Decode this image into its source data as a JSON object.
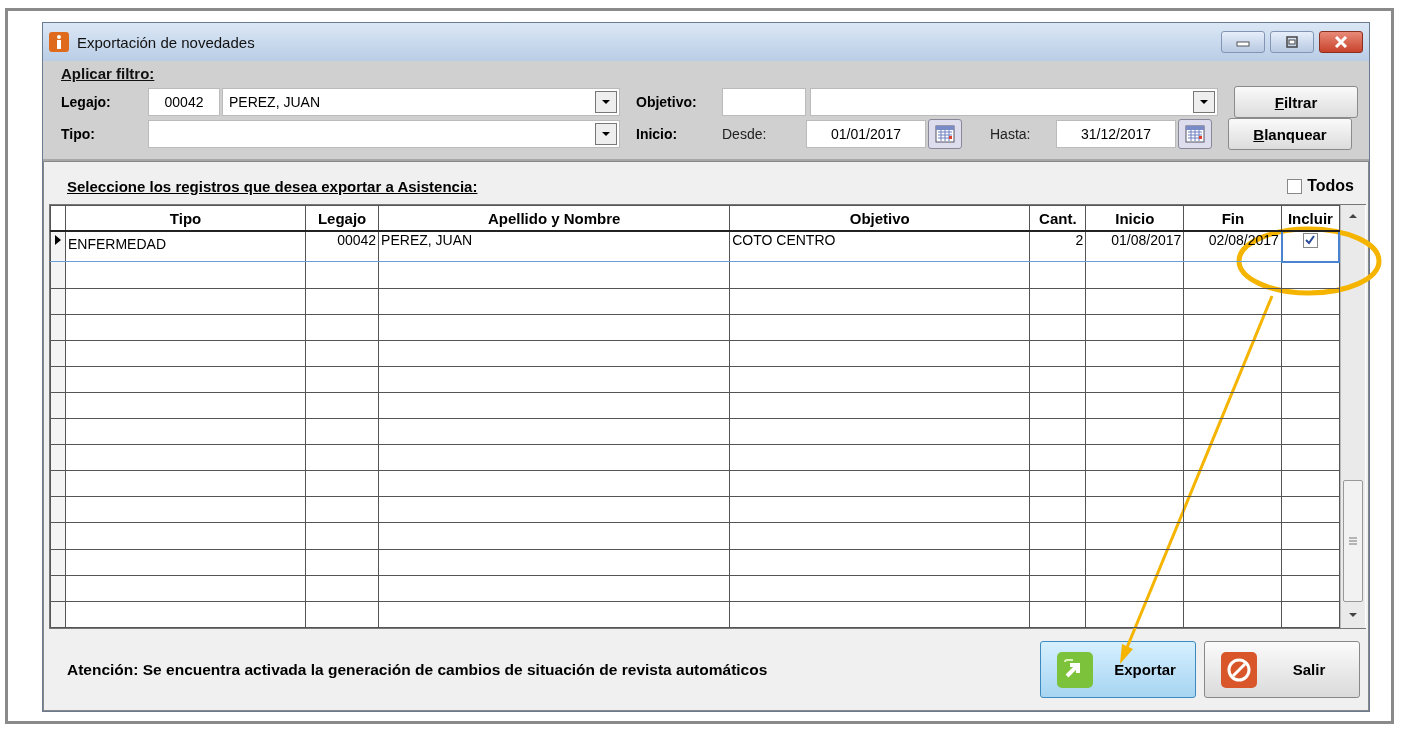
{
  "window": {
    "title": "Exportación de novedades"
  },
  "filter": {
    "heading": "Aplicar filtro:",
    "legajo": {
      "label": "Legajo:",
      "code": "00042",
      "name": "PEREZ, JUAN"
    },
    "objetivo": {
      "label": "Objetivo:"
    },
    "tipo": {
      "label": "Tipo:"
    },
    "inicio": {
      "label": "Inicio:",
      "desde_label": "Desde:",
      "desde": "01/01/2017",
      "hasta_label": "Hasta:",
      "hasta": "31/12/2017"
    },
    "buttons": [
      {
        "label": "Filtrar",
        "mnemonic": true
      },
      {
        "label": "Blanquear",
        "mnemonic": true
      }
    ]
  },
  "selection": {
    "heading": "Seleccione los registros que desea exportar a Asistencia:",
    "todos": {
      "label": "Todos",
      "checked": false
    }
  },
  "table": {
    "columns": [
      "Tipo",
      "Legajo",
      "Apellido y Nombre",
      "Objetivo",
      "Cant.",
      "Inicio",
      "Fin",
      "Incluir"
    ],
    "rows": [
      {
        "selected": true,
        "cells": [
          "ENFERMEDAD",
          "00042",
          "PEREZ, JUAN",
          "COTO CENTRO",
          "2",
          "01/08/2017",
          "02/08/2017"
        ],
        "incluir": true
      }
    ]
  },
  "message": "Atención: Se encuentra activada la generación de cambios de situación de revista automáticos",
  "actions": [
    {
      "kind": "export",
      "label": "Exportar"
    },
    {
      "kind": "exit",
      "label": "Salir"
    }
  ]
}
